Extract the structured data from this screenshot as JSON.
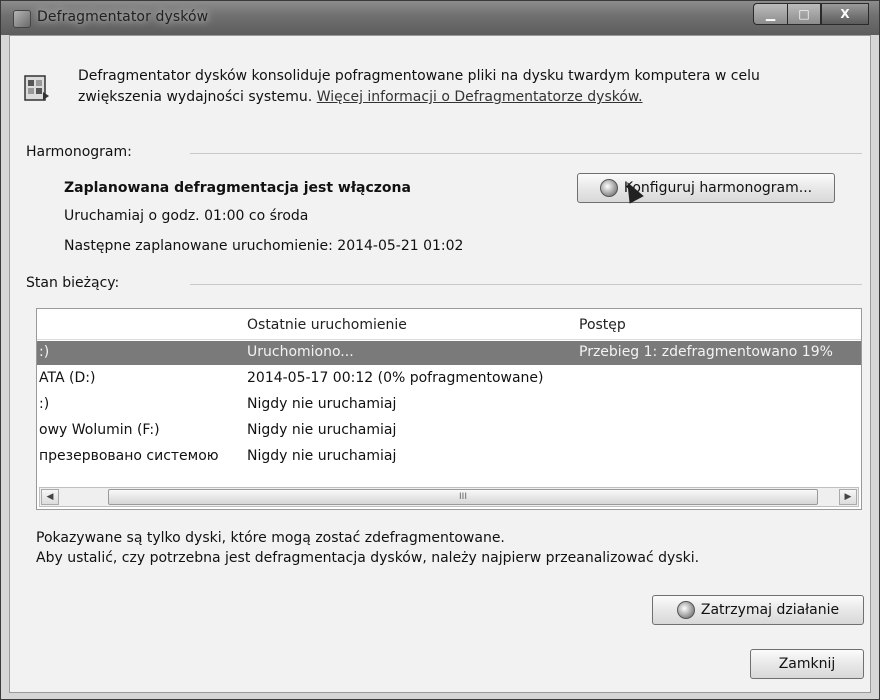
{
  "window": {
    "title": "Defragmentator dysków"
  },
  "intro": {
    "text": "Defragmentator dysków konsoliduje pofragmentowane pliki na dysku twardym komputera w celu zwiększenia wydajności systemu.",
    "link": "Więcej informacji o Defragmentatorze dysków."
  },
  "schedule": {
    "label": "Harmonogram:",
    "status": "Zaplanowana defragmentacja jest włączona",
    "run_when": "Uruchamiaj o godz. 01:00 co środa",
    "next_run": "Następne zaplanowane uruchomienie: 2014-05-21 01:02",
    "configure_button": "Konfiguruj harmonogram..."
  },
  "current": {
    "label": "Stan bieżący:",
    "columns": [
      "",
      "Ostatnie uruchomienie",
      "Postęp"
    ],
    "rows": [
      {
        "name": ":)",
        "last": "Uruchomiono...",
        "progress": "Przebieg 1: zdefragmentowano 19%",
        "selected": true
      },
      {
        "name": "ATA (D:)",
        "last": "2014-05-17 00:12 (0% pofragmentowane)",
        "progress": "",
        "selected": false
      },
      {
        "name": ":)",
        "last": "Nigdy nie uruchamiaj",
        "progress": "",
        "selected": false
      },
      {
        "name": "owy Wolumin  (F:)",
        "last": "Nigdy nie uruchamiaj",
        "progress": "",
        "selected": false
      },
      {
        "name": "презервовано системою",
        "last": "Nigdy nie uruchamiaj",
        "progress": "",
        "selected": false
      }
    ],
    "scroll_thumb_label": "III"
  },
  "notes": {
    "line1": "Pokazywane są tylko dyski, które mogą zostać zdefragmentowane.",
    "line2": "Aby ustalić, czy potrzebna jest defragmentacja dysków, należy najpierw przeanalizować dyski."
  },
  "buttons": {
    "stop": "Zatrzymaj działanie",
    "close": "Zamknij"
  }
}
